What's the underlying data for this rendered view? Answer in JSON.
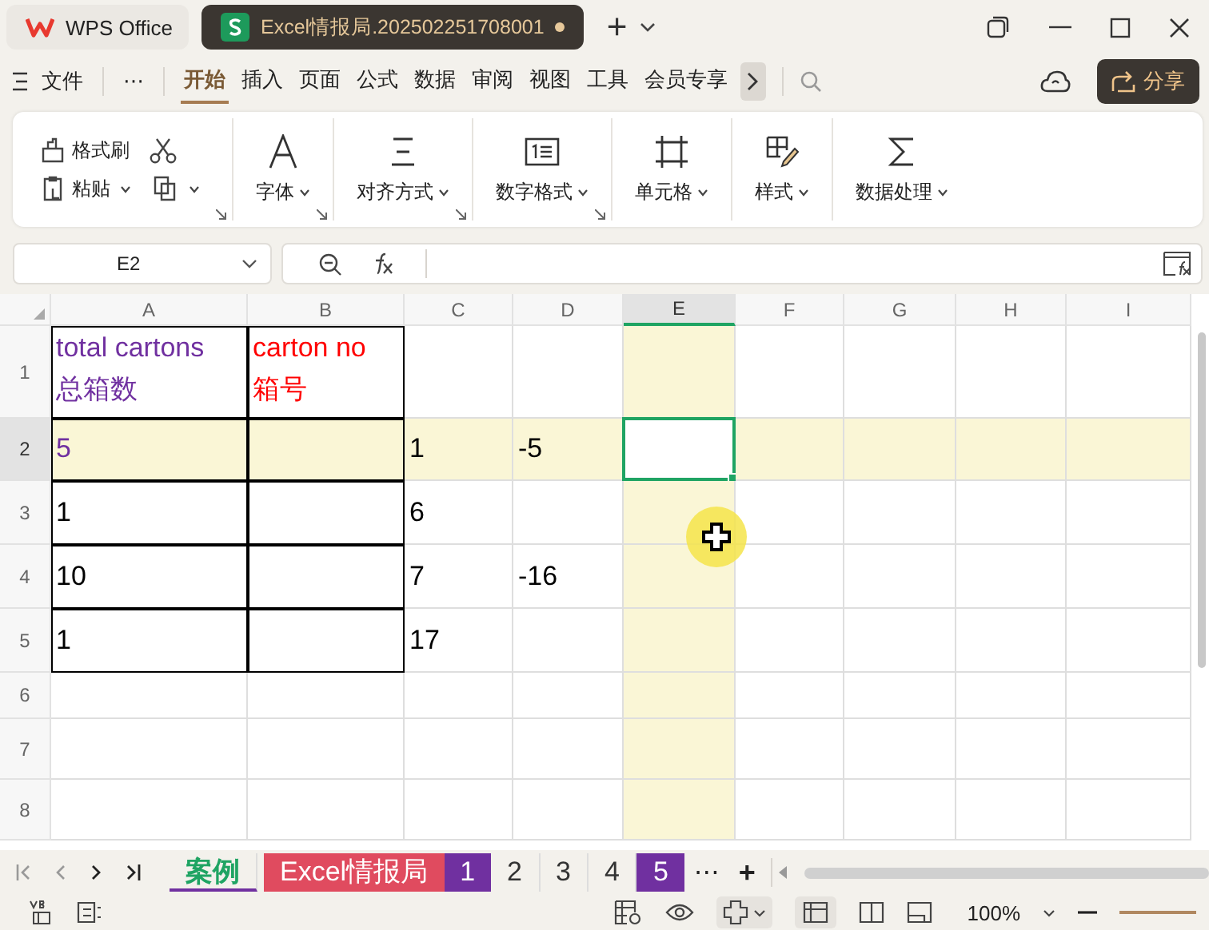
{
  "window": {
    "tabs": [
      {
        "label": "WPS Office",
        "kind": "home",
        "selected": false
      },
      {
        "label": "Excel情报局.202502251708001",
        "kind": "document",
        "selected": true,
        "unsaved": true
      }
    ],
    "new_tab": "+"
  },
  "menu": {
    "file": "文件",
    "more": "⋯",
    "tabs": [
      {
        "label": "开始",
        "selected": true
      },
      {
        "label": "插入",
        "selected": false
      },
      {
        "label": "页面",
        "selected": false
      },
      {
        "label": "公式",
        "selected": false
      },
      {
        "label": "数据",
        "selected": false
      },
      {
        "label": "审阅",
        "selected": false
      },
      {
        "label": "视图",
        "selected": false
      },
      {
        "label": "工具",
        "selected": false
      },
      {
        "label": "会员专享",
        "selected": false
      }
    ],
    "share": "分享"
  },
  "ribbon": {
    "clipboard": {
      "format_painter": "格式刷",
      "paste": "粘贴",
      "launcher": true
    },
    "groups": [
      {
        "kind": "font",
        "label": "字体",
        "launcher": true
      },
      {
        "kind": "align",
        "label": "对齐方式",
        "launcher": true
      },
      {
        "kind": "number",
        "label": "数字格式",
        "launcher": true
      },
      {
        "kind": "cells",
        "label": "单元格",
        "launcher": false
      },
      {
        "kind": "styles",
        "label": "样式",
        "launcher": false
      },
      {
        "kind": "data",
        "label": "数据处理",
        "launcher": false
      }
    ]
  },
  "formula_bar": {
    "name_box": "E2"
  },
  "sheet": {
    "columns": [
      {
        "label": "A",
        "selected": false
      },
      {
        "label": "B",
        "selected": false
      },
      {
        "label": "C",
        "selected": false
      },
      {
        "label": "D",
        "selected": false
      },
      {
        "label": "E",
        "selected": true
      },
      {
        "label": "F",
        "selected": false
      },
      {
        "label": "G",
        "selected": false
      },
      {
        "label": "H",
        "selected": false
      },
      {
        "label": "I",
        "selected": false
      }
    ],
    "rows": [
      {
        "label": "1",
        "selected": false,
        "cells": [
          {
            "text": "total cartons\n总箱数",
            "color": "#7030a0",
            "bordered": true
          },
          {
            "text": "carton no\n箱号",
            "color": "#ff0000",
            "bordered": true
          }
        ]
      },
      {
        "label": "2",
        "selected": true,
        "cells": [
          {
            "text": "5",
            "color": "#7030a0",
            "bordered": true
          },
          {
            "bordered": true
          },
          {
            "text": "1"
          },
          {
            "text": "-5"
          }
        ]
      },
      {
        "label": "3",
        "selected": false,
        "cells": [
          {
            "text": "1",
            "bordered": true
          },
          {
            "bordered": true
          },
          {
            "text": "6"
          }
        ]
      },
      {
        "label": "4",
        "selected": false,
        "cells": [
          {
            "text": "10",
            "bordered": true
          },
          {
            "bordered": true
          },
          {
            "text": "7"
          },
          {
            "text": "-16"
          }
        ]
      },
      {
        "label": "5",
        "selected": false,
        "cells": [
          {
            "text": "1",
            "bordered": true
          },
          {
            "bordered": true
          },
          {
            "text": "17"
          }
        ]
      },
      {
        "label": "6",
        "selected": false
      },
      {
        "label": "7",
        "selected": false
      },
      {
        "label": "8",
        "selected": false
      }
    ]
  },
  "sheet_tabs": {
    "tabs": [
      {
        "label": "案例",
        "selected": true
      },
      {
        "label": "Excel情报局",
        "selected": false,
        "color": "#e04b5f"
      },
      {
        "label": "1",
        "selected": false,
        "color": "#7030a0"
      },
      {
        "label": "2",
        "selected": false
      },
      {
        "label": "3",
        "selected": false
      },
      {
        "label": "4",
        "selected": false
      },
      {
        "label": "5",
        "selected": false,
        "color": "#7030a0"
      }
    ],
    "more": "⋯",
    "add": "+"
  },
  "status_bar": {
    "zoom": "100%"
  }
}
